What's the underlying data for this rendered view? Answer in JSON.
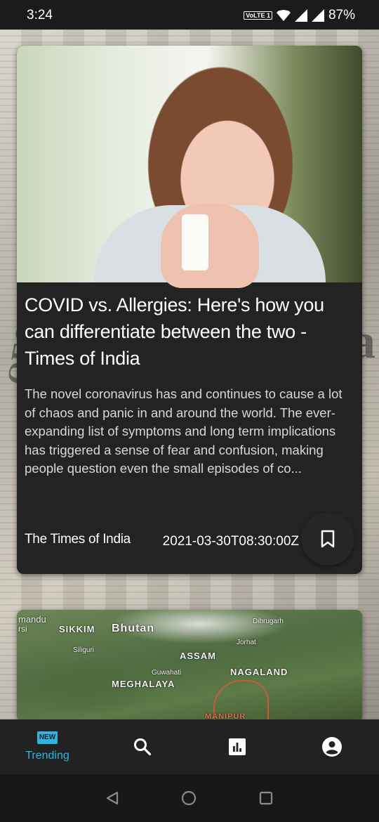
{
  "status_bar": {
    "time": "3:24",
    "volte": "VoLTE 1",
    "battery": "87%"
  },
  "article": {
    "title": "COVID vs. Allergies: Here's how you can differentiate between the two - Times of India",
    "description": "The novel coronavirus has and continues to cause a lot of chaos and panic in and around the world. The ever-expanding list of symptoms and long term implications has triggered a sense of fear and confusion, making people question even the small episodes of co...",
    "source": "The Times of India",
    "date": "2021-03-30T08:30:00Z",
    "image_icon": "woman-sneezing-photo",
    "bookmark_icon": "bookmark-icon"
  },
  "next_article": {
    "map_labels": {
      "mandu": "mandu",
      "rsi": "rsi",
      "sikkim": "SIKKIM",
      "bhutan": "Bhutan",
      "siliguri": "Siliguri",
      "dibrugarh": "Dibrugarh",
      "jorhat": "Jorhat",
      "assam": "ASSAM",
      "guwahati": "Guwahati",
      "nagaland": "NAGALAND",
      "meghalaya": "MEGHALAYA",
      "manipur": "MANIPUR"
    }
  },
  "nav": {
    "items": [
      {
        "label": "Trending",
        "icon": "new-badge-icon",
        "active": true,
        "badge": "NEW"
      },
      {
        "label": "",
        "icon": "search-icon",
        "active": false
      },
      {
        "label": "",
        "icon": "bar-chart-icon",
        "active": false
      },
      {
        "label": "",
        "icon": "account-icon",
        "active": false
      }
    ]
  },
  "colors": {
    "accent": "#2fb3e3",
    "card_bg": "#232323",
    "nav_bg": "#222222"
  }
}
